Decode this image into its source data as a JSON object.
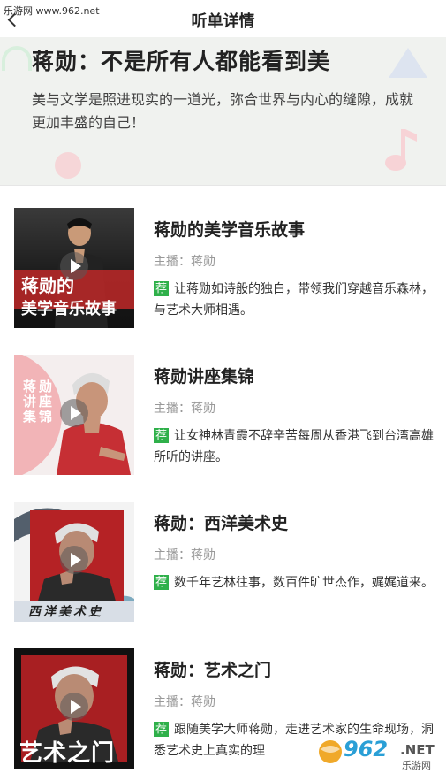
{
  "watermark_top": "乐游网 www.962.net",
  "header": {
    "title": "听单详情"
  },
  "banner": {
    "title": "蒋勋：不是所有人都能看到美",
    "description": "美与文学是照进现实的一道光，弥合世界与内心的缝隙，成就更加丰盛的自己！"
  },
  "items": [
    {
      "title": "蒋勋的美学音乐故事",
      "host": "主播：蒋勋",
      "rec_tag": "荐",
      "description": "让蒋勋如诗般的独白，带领我们穿越音乐森林，与艺术大师相遇。",
      "thumb_text_1": "蒋勋的",
      "thumb_text_2": "美学音乐故事"
    },
    {
      "title": "蒋勋讲座集锦",
      "host": "主播：蒋勋",
      "rec_tag": "荐",
      "description": "让女神林青霞不辞辛苦每周从香港飞到台湾高雄所听的讲座。",
      "thumb_col_1": "蒋讲集",
      "thumb_col_2": "勋座锦"
    },
    {
      "title": "蒋勋：西洋美术史",
      "host": "主播：蒋勋",
      "rec_tag": "荐",
      "description": "数千年艺林往事，数百件旷世杰作，娓娓道来。",
      "thumb_text": "西洋美术史"
    },
    {
      "title": "蒋勋：艺术之门",
      "host": "主播：蒋勋",
      "rec_tag": "荐",
      "description": "跟随美学大师蒋勋，走进艺术家的生命现场，洞悉艺术史上真实的理",
      "thumb_text": "艺术之门"
    }
  ],
  "watermark_bottom": {
    "number": "962",
    "net": ".NET",
    "site": "乐游网"
  }
}
